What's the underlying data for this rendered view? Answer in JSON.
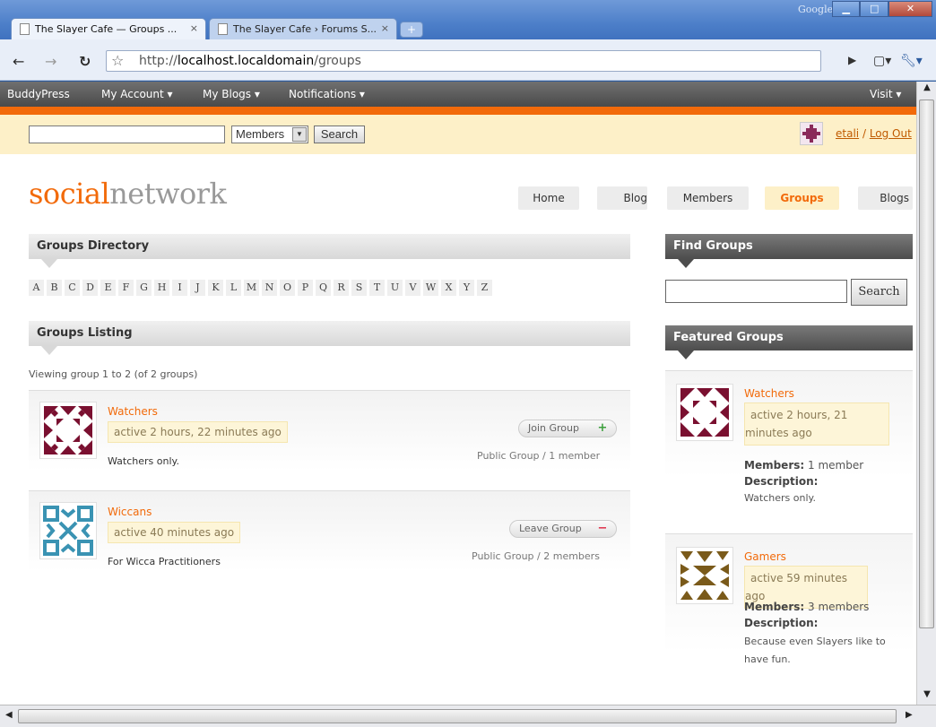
{
  "browser": {
    "tabs": [
      {
        "title": "The Slayer Cafe — Groups ...",
        "close": "×"
      },
      {
        "title": "The Slayer Cafe › Forums S...",
        "close": "×"
      }
    ],
    "new_tab": "+",
    "google_label": "Google",
    "url_prefix": "http://",
    "url_host": "localhost.localdomain",
    "url_path": "/groups"
  },
  "adminbar": {
    "brand": "BuddyPress",
    "items": [
      "My Account ▾",
      "My Blogs ▾",
      "Notifications ▾"
    ],
    "visit": "Visit ▾"
  },
  "searchbar": {
    "select_value": "Members",
    "button": "Search"
  },
  "user": {
    "name": "etali",
    "separator": "/",
    "logout": "Log Out"
  },
  "logo": {
    "part1": "social",
    "part2": "network"
  },
  "nav": [
    "Home",
    "Blog",
    "Members",
    "Groups",
    "Blogs"
  ],
  "directory": {
    "title": "Groups Directory",
    "letters": [
      "A",
      "B",
      "C",
      "D",
      "E",
      "F",
      "G",
      "H",
      "I",
      "J",
      "K",
      "L",
      "M",
      "N",
      "O",
      "P",
      "Q",
      "R",
      "S",
      "T",
      "U",
      "V",
      "W",
      "X",
      "Y",
      "Z"
    ]
  },
  "listing": {
    "title": "Groups Listing",
    "viewing": "Viewing group 1 to 2 (of 2 groups)",
    "groups": [
      {
        "name": "Watchers",
        "active": "active 2 hours, 22 minutes ago",
        "desc": "Watchers only.",
        "button": "Join Group",
        "button_symbol": "+",
        "type": "Public Group / 1 member"
      },
      {
        "name": "Wiccans",
        "active": "active 40 minutes ago",
        "desc": "For Wicca Practitioners",
        "button": "Leave Group",
        "button_symbol": "−",
        "type": "Public Group / 2 members"
      }
    ]
  },
  "find": {
    "title": "Find Groups",
    "button": "Search"
  },
  "featured": {
    "title": "Featured Groups",
    "members_label": "Members:",
    "description_label": "Description:",
    "groups": [
      {
        "name": "Watchers",
        "active": "active 2 hours, 21 minutes ago",
        "members": "1 member",
        "desc": "Watchers only."
      },
      {
        "name": "Gamers",
        "active": "active 59 minutes ago",
        "members": "3 members",
        "desc": "Because even Slayers like to have fun."
      }
    ]
  },
  "colors": {
    "accent": "#f26a0a",
    "highlight": "#fdf0c8",
    "watchers": "#7a1030",
    "wiccans": "#3a93b3",
    "gamers": "#7a5a1a"
  }
}
